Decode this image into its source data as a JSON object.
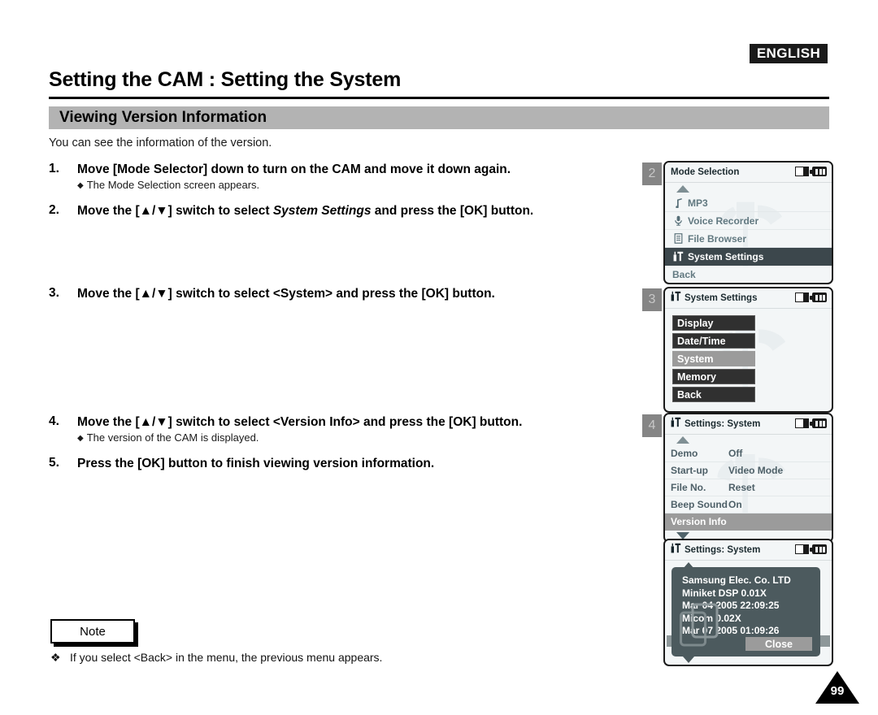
{
  "header": {
    "language_badge": "ENGLISH",
    "title": "Setting the CAM : Setting the System",
    "section_title": "Viewing Version Information",
    "intro": "You can see the information of the version."
  },
  "steps": [
    {
      "num": "1.",
      "text": "Move [Mode Selector] down to turn on the CAM and move it down again.",
      "sub": "The Mode Selection screen appears."
    },
    {
      "num": "2.",
      "text_pre": "Move the [▲/▼] switch to select ",
      "text_italic": "System Settings",
      "text_post": " and press the [OK] button."
    },
    {
      "num": "3.",
      "text": "Move the [▲/▼] switch to select <System> and press the [OK] button."
    },
    {
      "num": "4.",
      "text": "Move the [▲/▼] switch to select <Version Info> and press the [OK] button.",
      "sub": "The version of the CAM is displayed."
    },
    {
      "num": "5.",
      "text": "Press the [OK] button to finish viewing version information."
    }
  ],
  "note": {
    "label": "Note",
    "bullet": "❖",
    "text": "If you select <Back> in the menu, the previous menu appears."
  },
  "page_number": "99",
  "panels": {
    "mode_selection": {
      "badge": "2",
      "title": "Mode Selection",
      "title_icon": "none",
      "status_icons": [
        "memory-card-icon",
        "battery-icon"
      ],
      "scroll_up": true,
      "items": [
        {
          "label": "MP3",
          "icon": "music-note-icon",
          "selected": false
        },
        {
          "label": "Voice Recorder",
          "icon": "microphone-icon",
          "selected": false
        },
        {
          "label": "File Browser",
          "icon": "document-icon",
          "selected": false
        },
        {
          "label": "System Settings",
          "icon": "tools-icon",
          "selected": true
        },
        {
          "label": "Back",
          "icon": "none",
          "selected": false
        }
      ]
    },
    "system_settings": {
      "badge": "3",
      "title": "System Settings",
      "title_icon": "tools-icon",
      "status_icons": [
        "memory-card-icon",
        "battery-icon"
      ],
      "items": [
        {
          "label": "Display",
          "selected": false
        },
        {
          "label": "Date/Time",
          "selected": false
        },
        {
          "label": "System",
          "selected": true
        },
        {
          "label": "Memory",
          "selected": false
        },
        {
          "label": "Back",
          "selected": false
        }
      ]
    },
    "settings_system": {
      "badge": "4",
      "title": "Settings: System",
      "title_icon": "tools-icon",
      "status_icons": [
        "memory-card-icon",
        "battery-icon"
      ],
      "scroll_up": true,
      "scroll_down": true,
      "rows": [
        {
          "key": "Demo",
          "value": "Off",
          "selected": false
        },
        {
          "key": "Start-up",
          "value": "Video Mode",
          "selected": false
        },
        {
          "key": "File No.",
          "value": "Reset",
          "selected": false
        },
        {
          "key": "Beep Sound",
          "value": "On",
          "selected": false
        },
        {
          "key": "Version Info",
          "value": "",
          "selected": true
        }
      ]
    },
    "version_info": {
      "title": "Settings: System",
      "title_icon": "tools-icon",
      "status_icons": [
        "memory-card-icon",
        "battery-icon"
      ],
      "lines": [
        "Samsung Elec. Co. LTD",
        "Miniket DSP 0.01X",
        "Mar 04 2005 22:09:25",
        "Micom 0.02X",
        "Mar 07 2005 01:09:26"
      ],
      "close_label": "Close"
    }
  },
  "colors": {
    "section_bar": "#b3b3b3",
    "lcd_background": "#f3f6f7",
    "lcd_selected_dark": "#3c474c",
    "lcd_selected_gray": "#9b9b9b",
    "lcd_button": "#303030",
    "dialog_background": "#4c5a5e",
    "badge": "#858585",
    "text_dark": "#000000"
  }
}
